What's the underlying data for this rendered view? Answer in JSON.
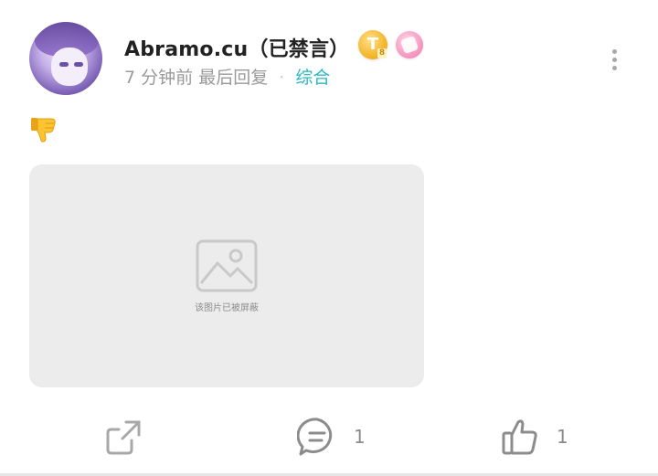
{
  "post": {
    "author": {
      "name": "Abramo.cu（已禁言）",
      "badges": [
        {
          "icon": "gold-t-badge",
          "text": "T",
          "level": "8",
          "color": "#f2b01e"
        },
        {
          "icon": "pink-rabbit-badge",
          "color": "#f48dbb"
        }
      ]
    },
    "time": "7 分钟前",
    "last_reply": "最后回复",
    "separator": "·",
    "category": "综合",
    "content_emoji": "thumbs-down-emoji",
    "image": {
      "caption": "该图片已被屏蔽",
      "icon": "image-placeholder-icon"
    }
  },
  "actions": {
    "share": {
      "icon": "share-icon"
    },
    "comment": {
      "icon": "comment-icon",
      "count": "1"
    },
    "like": {
      "icon": "thumbs-up-icon",
      "count": "1"
    }
  },
  "colors": {
    "category": "#2bb7c1",
    "muted_text": "#9a9a9a",
    "image_bg": "#ececec"
  }
}
